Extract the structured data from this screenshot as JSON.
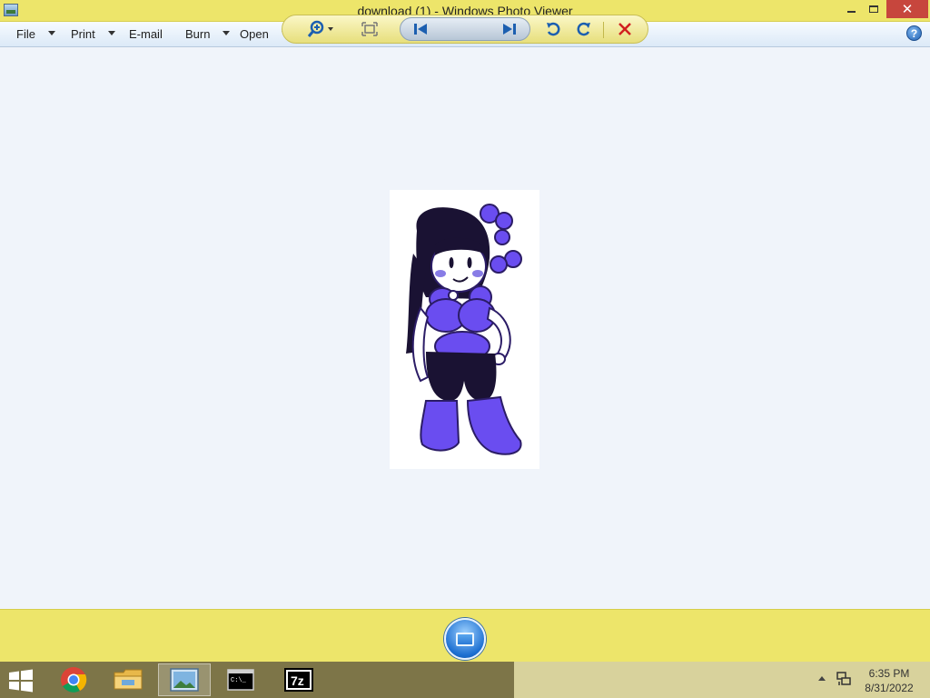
{
  "window": {
    "title": "download (1) - Windows Photo Viewer",
    "close_glyph": "✕"
  },
  "menu": {
    "file": "File",
    "print": "Print",
    "email": "E-mail",
    "burn": "Burn",
    "open": "Open",
    "help_glyph": "?"
  },
  "controls": {
    "icons": [
      "zoom-icon",
      "actual-size-icon",
      "previous-icon",
      "slideshow-icon",
      "next-icon",
      "rotate-counterclockwise-icon",
      "rotate-clockwise-icon",
      "delete-icon"
    ],
    "delete_color": "#d11f1f",
    "accent_color": "#1c6fd1"
  },
  "taskbar": {
    "apps": [
      "chrome-icon",
      "file-explorer-icon",
      "photo-viewer-icon",
      "command-prompt-icon",
      "7zip-icon"
    ],
    "cmd_text": "C:\\_",
    "sevenzip_text": "7z",
    "time": "6:35 PM",
    "date": "8/31/2022"
  }
}
